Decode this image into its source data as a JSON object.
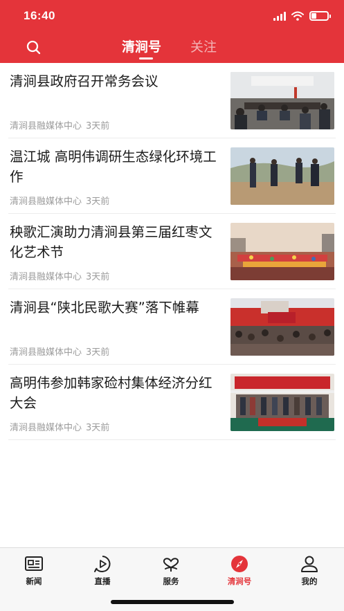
{
  "status_bar": {
    "time": "16:40",
    "signal_icon": "signal-icon",
    "wifi_icon": "wifi-icon",
    "battery_icon": "battery-icon",
    "battery_level": 0.3
  },
  "header": {
    "search_icon": "search-icon",
    "tabs": [
      {
        "label": "清涧号",
        "active": true
      },
      {
        "label": "关注",
        "active": false
      }
    ]
  },
  "colors": {
    "brand_red": "#e4343a",
    "inactive_tab": "#f3b3b5",
    "meta_gray": "#9b9b9b"
  },
  "news": [
    {
      "title": "清涧县政府召开常务会议",
      "source": "清涧县融媒体中心",
      "time": "3天前",
      "thumb": "meeting-photo"
    },
    {
      "title": "温江城 高明伟调研生态绿化环境工作",
      "source": "清涧县融媒体中心",
      "time": "3天前",
      "thumb": "inspection-photo"
    },
    {
      "title": "秧歌汇演助力清涧县第三届红枣文化艺术节",
      "source": "清涧县融媒体中心",
      "time": "3天前",
      "thumb": "festival-photo"
    },
    {
      "title": "清涧县“陕北民歌大赛”落下帷幕",
      "source": "清涧县融媒体中心",
      "time": "3天前",
      "thumb": "concert-photo"
    },
    {
      "title": "高明伟参加韩家硷村集体经济分红大会",
      "source": "清涧县融媒体中心",
      "time": "3天前",
      "thumb": "dividend-meeting-photo"
    }
  ],
  "tabbar": {
    "items": [
      {
        "label": "新闻",
        "icon": "newspaper-icon",
        "active": false
      },
      {
        "label": "直播",
        "icon": "play-icon",
        "active": false
      },
      {
        "label": "服务",
        "icon": "service-icon",
        "active": false
      },
      {
        "label": "清涧号",
        "icon": "compass-icon",
        "active": true
      },
      {
        "label": "我的",
        "icon": "user-icon",
        "active": false
      }
    ]
  }
}
